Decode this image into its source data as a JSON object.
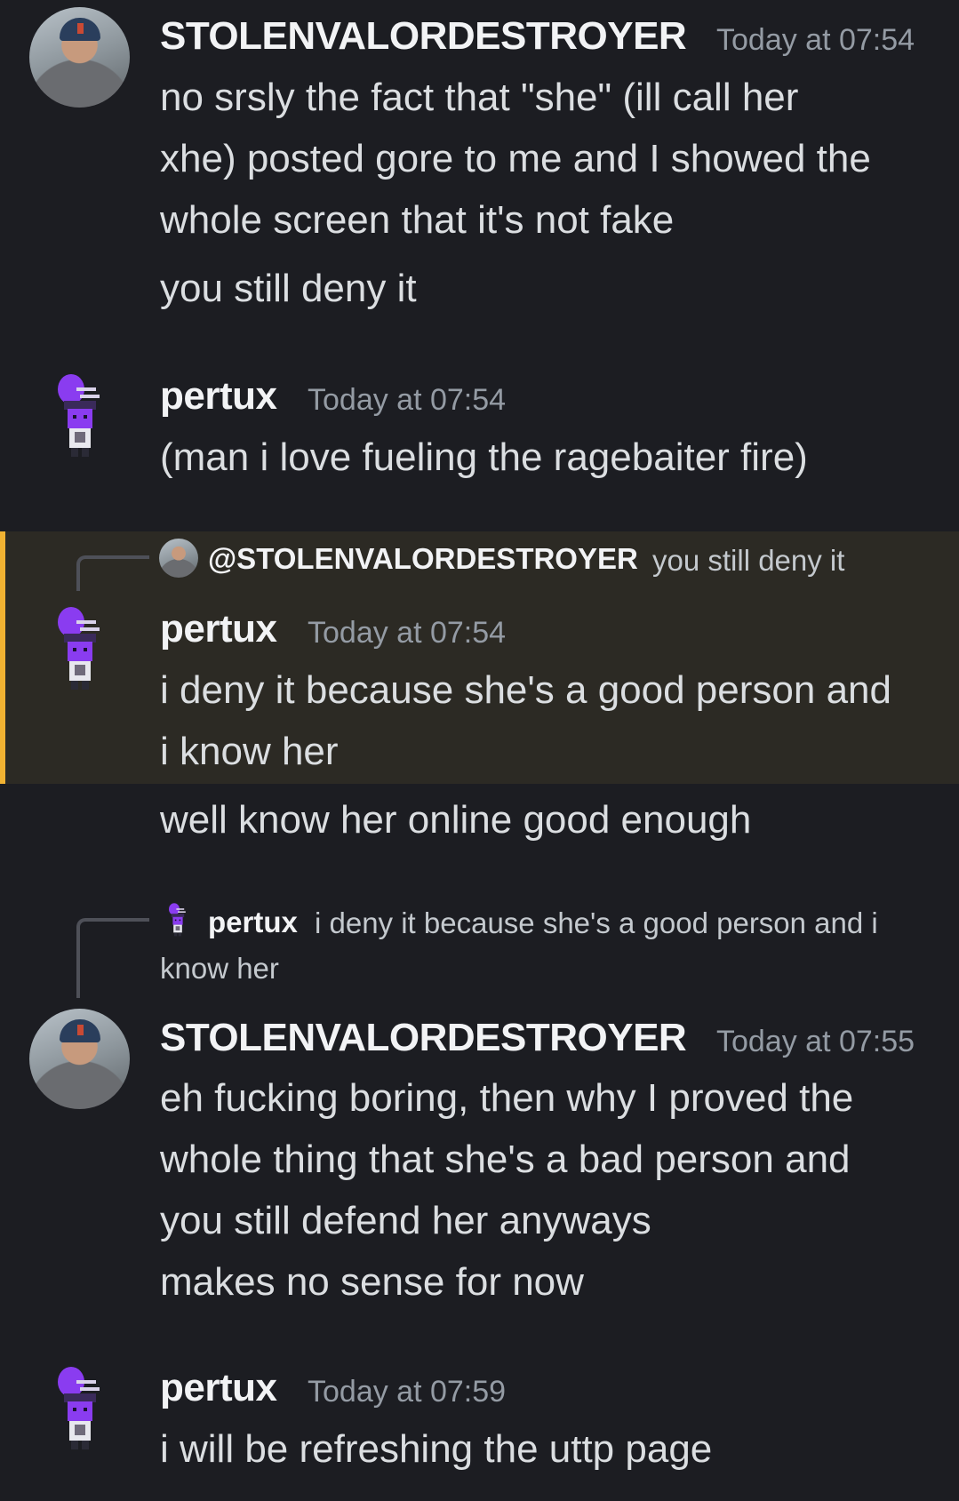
{
  "messages": [
    {
      "author": "STOLENVALORDESTROYER",
      "timestamp": "Today at 07:54",
      "lines": [
        "no srsly the fact that \"she\" (ill call her",
        "xhe) posted gore to me and I showed the",
        "whole screen that it's not fake"
      ],
      "followup": "you still deny it"
    },
    {
      "author": "pertux",
      "timestamp": "Today at 07:54",
      "lines": [
        "(man i love fueling the ragebaiter fire)"
      ]
    },
    {
      "reply": {
        "mention": "@STOLENVALORDESTROYER",
        "text": "you still deny it"
      },
      "author": "pertux",
      "timestamp": "Today at 07:54",
      "lines": [
        "i deny it because she's a good person and",
        "i know her"
      ],
      "followup": "well know her online good enough"
    },
    {
      "reply": {
        "name": "pertux",
        "text_line1": "i deny it because she's a good person and i",
        "text_line2": "know her"
      },
      "author": "STOLENVALORDESTROYER",
      "timestamp": "Today at 07:55",
      "lines": [
        "eh fucking boring, then why I proved the",
        "whole thing that she's a bad person and",
        "you still defend her anyways",
        "makes no sense for now"
      ]
    },
    {
      "author": "pertux",
      "timestamp": "Today at 07:59",
      "lines": [
        "i will be refreshing the uttp page"
      ]
    }
  ],
  "colors": {
    "background": "#1c1d22",
    "highlight_bg": "#2c2a24",
    "highlight_bar": "#f0b232",
    "pertux_purple": "#8a3cf0"
  }
}
